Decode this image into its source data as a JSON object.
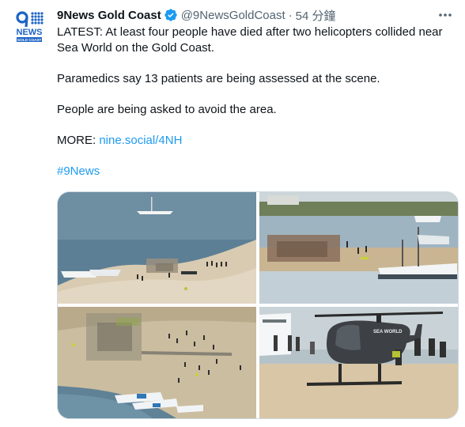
{
  "tweet": {
    "author_name": "9News Gold Coast",
    "handle": "@9NewsGoldCoast",
    "separator": "·",
    "timestamp": "54 分鐘",
    "logo": {
      "main": "9",
      "word": "NEWS",
      "sub": "GOLD COAST"
    },
    "paragraphs": {
      "p1": "LATEST: At least four people have died after two helicopters collided near Sea World on the Gold Coast.",
      "p2": "Paramedics say 13 patients are being assessed at the scene.",
      "p3": "People are being asked to avoid the area."
    },
    "more_prefix": "MORE: ",
    "more_link": "nine.social/4NH",
    "hashtag": "#9News",
    "photo_caption_text": "SEA WORLD"
  },
  "colors": {
    "link": "#1d9bf0",
    "verified": "#1d9bf0",
    "logo_blue": "#1e63c4"
  },
  "icons": [
    "avatar-9news-logo",
    "verified-badge-icon",
    "more-options-icon"
  ]
}
